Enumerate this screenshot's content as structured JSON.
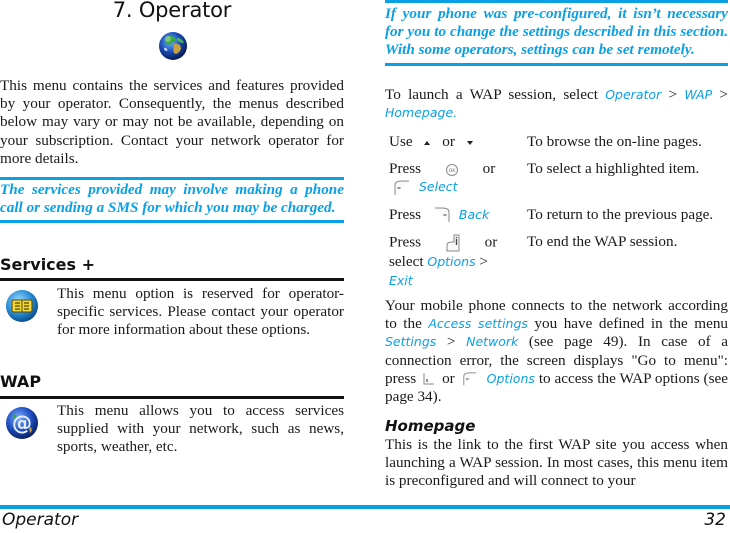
{
  "chapter": {
    "title": "7. Operator",
    "icon": "globe-icon"
  },
  "intro_text": "This menu contains the services and features provided by your operator. Consequently, the menus described below may vary or may not be available, depending on your subscription. Contact your network operator for more details.",
  "note_left": "The services provided may involve making a phone call or sending a SMS for which you may be charged.",
  "sections": [
    {
      "title": "Services +",
      "icon": "sim-services-icon",
      "text": "This menu option is reserved for operator-specific services. Please contact your operator for more information about these options."
    },
    {
      "title": "WAP",
      "icon": "wap-at-icon",
      "text": "This menu allows you to access services supplied with your network, such as news, sports, weather, etc."
    }
  ],
  "note_right": "If your phone was pre-configured, it isn’t necessary for you to change the settings described in this section. With some operators, settings can be set remotely.",
  "launch": {
    "prefix": "To launch a WAP session, select ",
    "path": [
      "Operator",
      "WAP",
      "Homepage."
    ],
    "separator": " > "
  },
  "keys_table": [
    {
      "key_parts": [
        "Use",
        "up-arrow-key",
        "or",
        "down-arrow-key"
      ],
      "desc": "To browse the on-line pages."
    },
    {
      "key_parts": [
        "Press",
        "ok-key",
        "or",
        "left-softkey",
        "Select"
      ],
      "desc": "To select a highlighted item."
    },
    {
      "key_parts": [
        "Press",
        "right-softkey",
        "Back"
      ],
      "desc": "To return to the previous page."
    },
    {
      "key_parts": [
        "Press",
        "end-key",
        "or",
        "select",
        "Options",
        ">",
        "Exit"
      ],
      "desc": "To end the WAP session."
    }
  ],
  "keys_labels": {
    "use": "Use",
    "or": "or",
    "press": "Press",
    "select_word": "select",
    "select_link": "Select",
    "back_link": "Back",
    "options_link": "Options",
    "gt": ">",
    "exit_link": "Exit"
  },
  "connect_para": {
    "t1": "Your mobile phone connects to the network according to the ",
    "link1": "Access settings",
    "t2": " you have defined in the menu ",
    "link2": "Settings",
    "sep": " > ",
    "link3": "Network",
    "t3": " (see page 49). In case of a connection error, the screen displays \"Go to menu\": press ",
    "or": " or ",
    "link4": "Options",
    "t4": " to access the WAP options (see page 34)."
  },
  "homepage": {
    "title": "Homepage",
    "text": "This is the link to the first WAP site you access when launching a WAP session. In most cases, this menu item is preconfigured and will connect to your"
  },
  "footer": {
    "section": "Operator",
    "page": "32"
  },
  "colors": {
    "accent": "#0aa0e6",
    "text": "#1a1a1a"
  }
}
